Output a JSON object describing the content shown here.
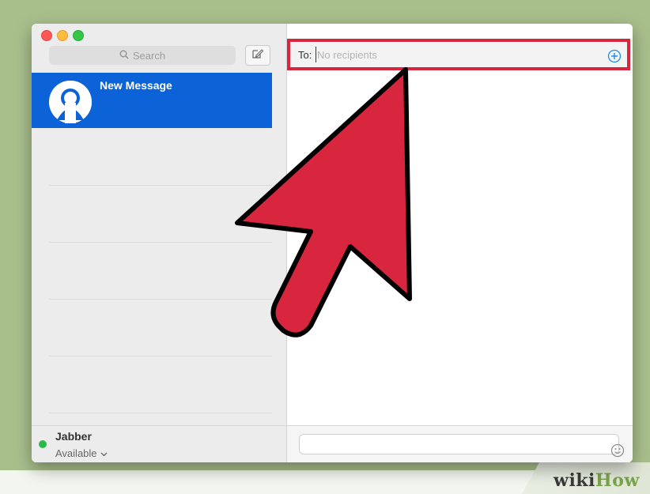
{
  "sidebar": {
    "search": {
      "placeholder": "Search",
      "icon": "search-icon"
    },
    "compose_icon": "compose-icon",
    "conversations": [
      {
        "name": "New Message",
        "avatar": "person-avatar-icon",
        "selected": true
      }
    ],
    "account": {
      "name": "Jabber",
      "status": "Available",
      "status_color": "#2bb94a"
    }
  },
  "main": {
    "to": {
      "label": "To:",
      "placeholder": "No recipients",
      "add_icon": "add-contact-icon"
    },
    "message": {
      "emoji_icon": "emoji-icon"
    }
  },
  "annotation": {
    "highlight_color": "#d7263d",
    "arrow_color": "#d7263d",
    "points_to": "to-field"
  },
  "watermark": {
    "text_wiki": "wiki",
    "text_how": "How"
  },
  "colors": {
    "selection_blue": "#0b63d7",
    "accent_blue": "#1a8cf0"
  }
}
